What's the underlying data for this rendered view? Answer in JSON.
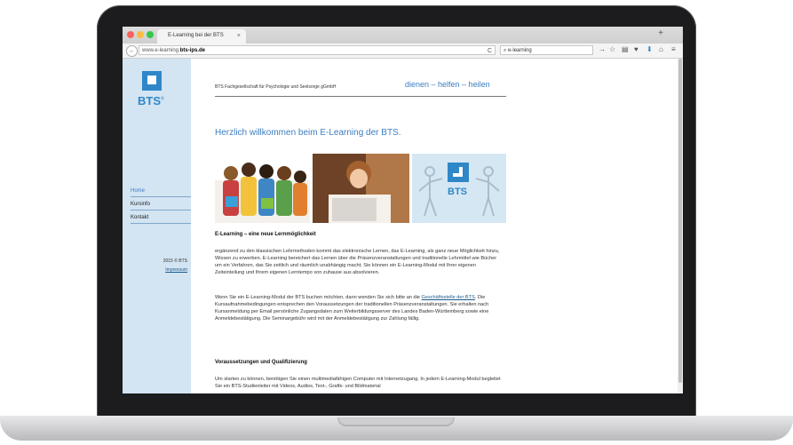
{
  "browser": {
    "tab_title": "E-Learning bei der BTS",
    "tab_close": "×",
    "new_tab": "+",
    "back_icon": "←",
    "url_prefix": "www.e-learning.",
    "url_domain": "bts-ips.de",
    "reload_icon": "C",
    "search_value": "e-learning",
    "toolbar_icons": [
      "→",
      "☆",
      "▤",
      "♥",
      "⬇",
      "⌂",
      "≡"
    ]
  },
  "sidebar": {
    "logo_text": "BTS",
    "logo_mark": "®",
    "items": [
      {
        "label": "Home",
        "color": "#3d7ec0"
      },
      {
        "label": "Kursinfo",
        "color": "#222222"
      },
      {
        "label": "Kontakt",
        "color": "#222222"
      }
    ],
    "copyright": "2015 © BTS",
    "impressum": "Impressum"
  },
  "header": {
    "organization": "BTS Fachgesellschaft für Psychologie und Seelsorge gGmbH",
    "tagline": "dienen – helfen – heilen"
  },
  "main": {
    "welcome": "Herzlich willkommen beim E-Learning der BTS.",
    "photo_logo_text": "BTS",
    "section1_title": "E-Learning – eine neue Lernmöglichkeit",
    "para1": "ergänzend zu den klassischen Lehrmethoden kommt das elektronische Lernen, das E-Learning, als ganz neue Möglichkeit hinzu, Wissen zu erwerben. E-Learning bereichert das Lernen über die Präsenzveranstaltungen und traditionelle Lehrmittel wie Bücher um ein Verfahren, das Sie zeitlich und räumlich unabhängig macht; Sie können ein E-Learning-Modul mit Ihrer eigenen Zeiteinteilung und Ihrem eigenen Lerntempo von zuhause aus absolvieren.",
    "para2_before": "Wenn Sie ein E-Learning-Modul der BTS buchen möchten, dann wenden Sie sich bitte an die ",
    "para2_link": "Geschäftsstelle der BTS",
    "para2_after": ". Die Kursaufnahmebedingungen entsprechen den Voraussetzungen der traditionellen Präsenzveranstaltungen. Sie erhalten nach Kursanmeldung per Email persönliche Zugangsdaten zum Weiterbildungsserver des Landes Baden-Württemberg sowie eine Anmeldebestätigung. Die Seminargebühr wird mit der Anmeldebestätigung zur Zahlung fällig.",
    "section2_title": "Voraussetzungen und Qualifizierung",
    "para3": "Um starten zu können, benötigen Sie einen multimediafähigen Computer mit Internetzugang. In jedem E-Learning-Modul begleitet Sie ein BTS-Studienleiter mit Videos, Audios, Text-, Grafik- und Bildmaterial"
  },
  "colors": {
    "accent": "#3d7ec0",
    "sidebar_bg": "#d3e4f3",
    "logo_blue": "#2f87c7"
  }
}
